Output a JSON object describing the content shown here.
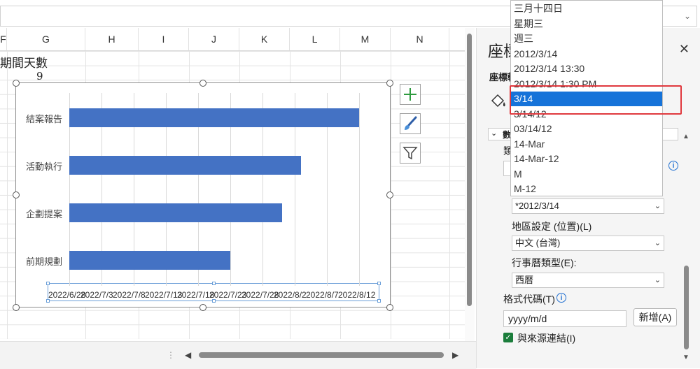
{
  "formula_bar": {
    "dropdown_icon": "chevron-down-icon"
  },
  "columns": [
    "F",
    "G",
    "H",
    "I",
    "J",
    "K",
    "L",
    "M",
    "N"
  ],
  "cells": {
    "title": "期間天數",
    "number": "9"
  },
  "chart": {
    "buttons": [
      "plus-icon",
      "brush-icon",
      "filter-icon"
    ]
  },
  "chart_data": {
    "type": "bar",
    "orientation": "horizontal",
    "categories": [
      "結案報告",
      "活動執行",
      "企劃提案",
      "前期規劃"
    ],
    "series": [
      {
        "values": [
          "2022/8/12",
          "2022/8/3",
          "2022/7/31",
          "2022/7/23"
        ]
      }
    ],
    "x_tick_labels": [
      "2022/6/28",
      "2022/7/3",
      "2022/7/8",
      "2022/7/13",
      "2022/7/18",
      "2022/7/23",
      "2022/7/28",
      "2022/8/2",
      "2022/8/7",
      "2022/8/12"
    ],
    "xlim": [
      "2022/6/28",
      "2022/8/12"
    ],
    "grid": true,
    "color": "#4472c4"
  },
  "pane": {
    "title": "座標軸格式",
    "subtitle": "座標軸選項",
    "section_label": "數值",
    "category_label": "類別",
    "type_select": "*2012/3/14",
    "locale_label": "地區設定 (位置)(L)",
    "locale_value": "中文 (台灣)",
    "calendar_label": "行事曆類型(E):",
    "calendar_value": "西曆",
    "format_code_label": "格式代碼(T)",
    "format_code_value": "yyyy/m/d",
    "add_button": "新增(A)",
    "link_label": "與來源連結(I)",
    "close_icon": "close-icon"
  },
  "dropdown": {
    "items": [
      "三月十四日",
      "星期三",
      "週三",
      "2012/3/14",
      "2012/3/14 13:30",
      "2012/3/14 1:30 PM",
      "3/14",
      "3/14/12",
      "03/14/12",
      "14-Mar",
      "14-Mar-12",
      "M",
      "M-12"
    ],
    "selected": "3/14"
  },
  "accent_color": "#1673d9",
  "highlight_color": "#e0393e"
}
